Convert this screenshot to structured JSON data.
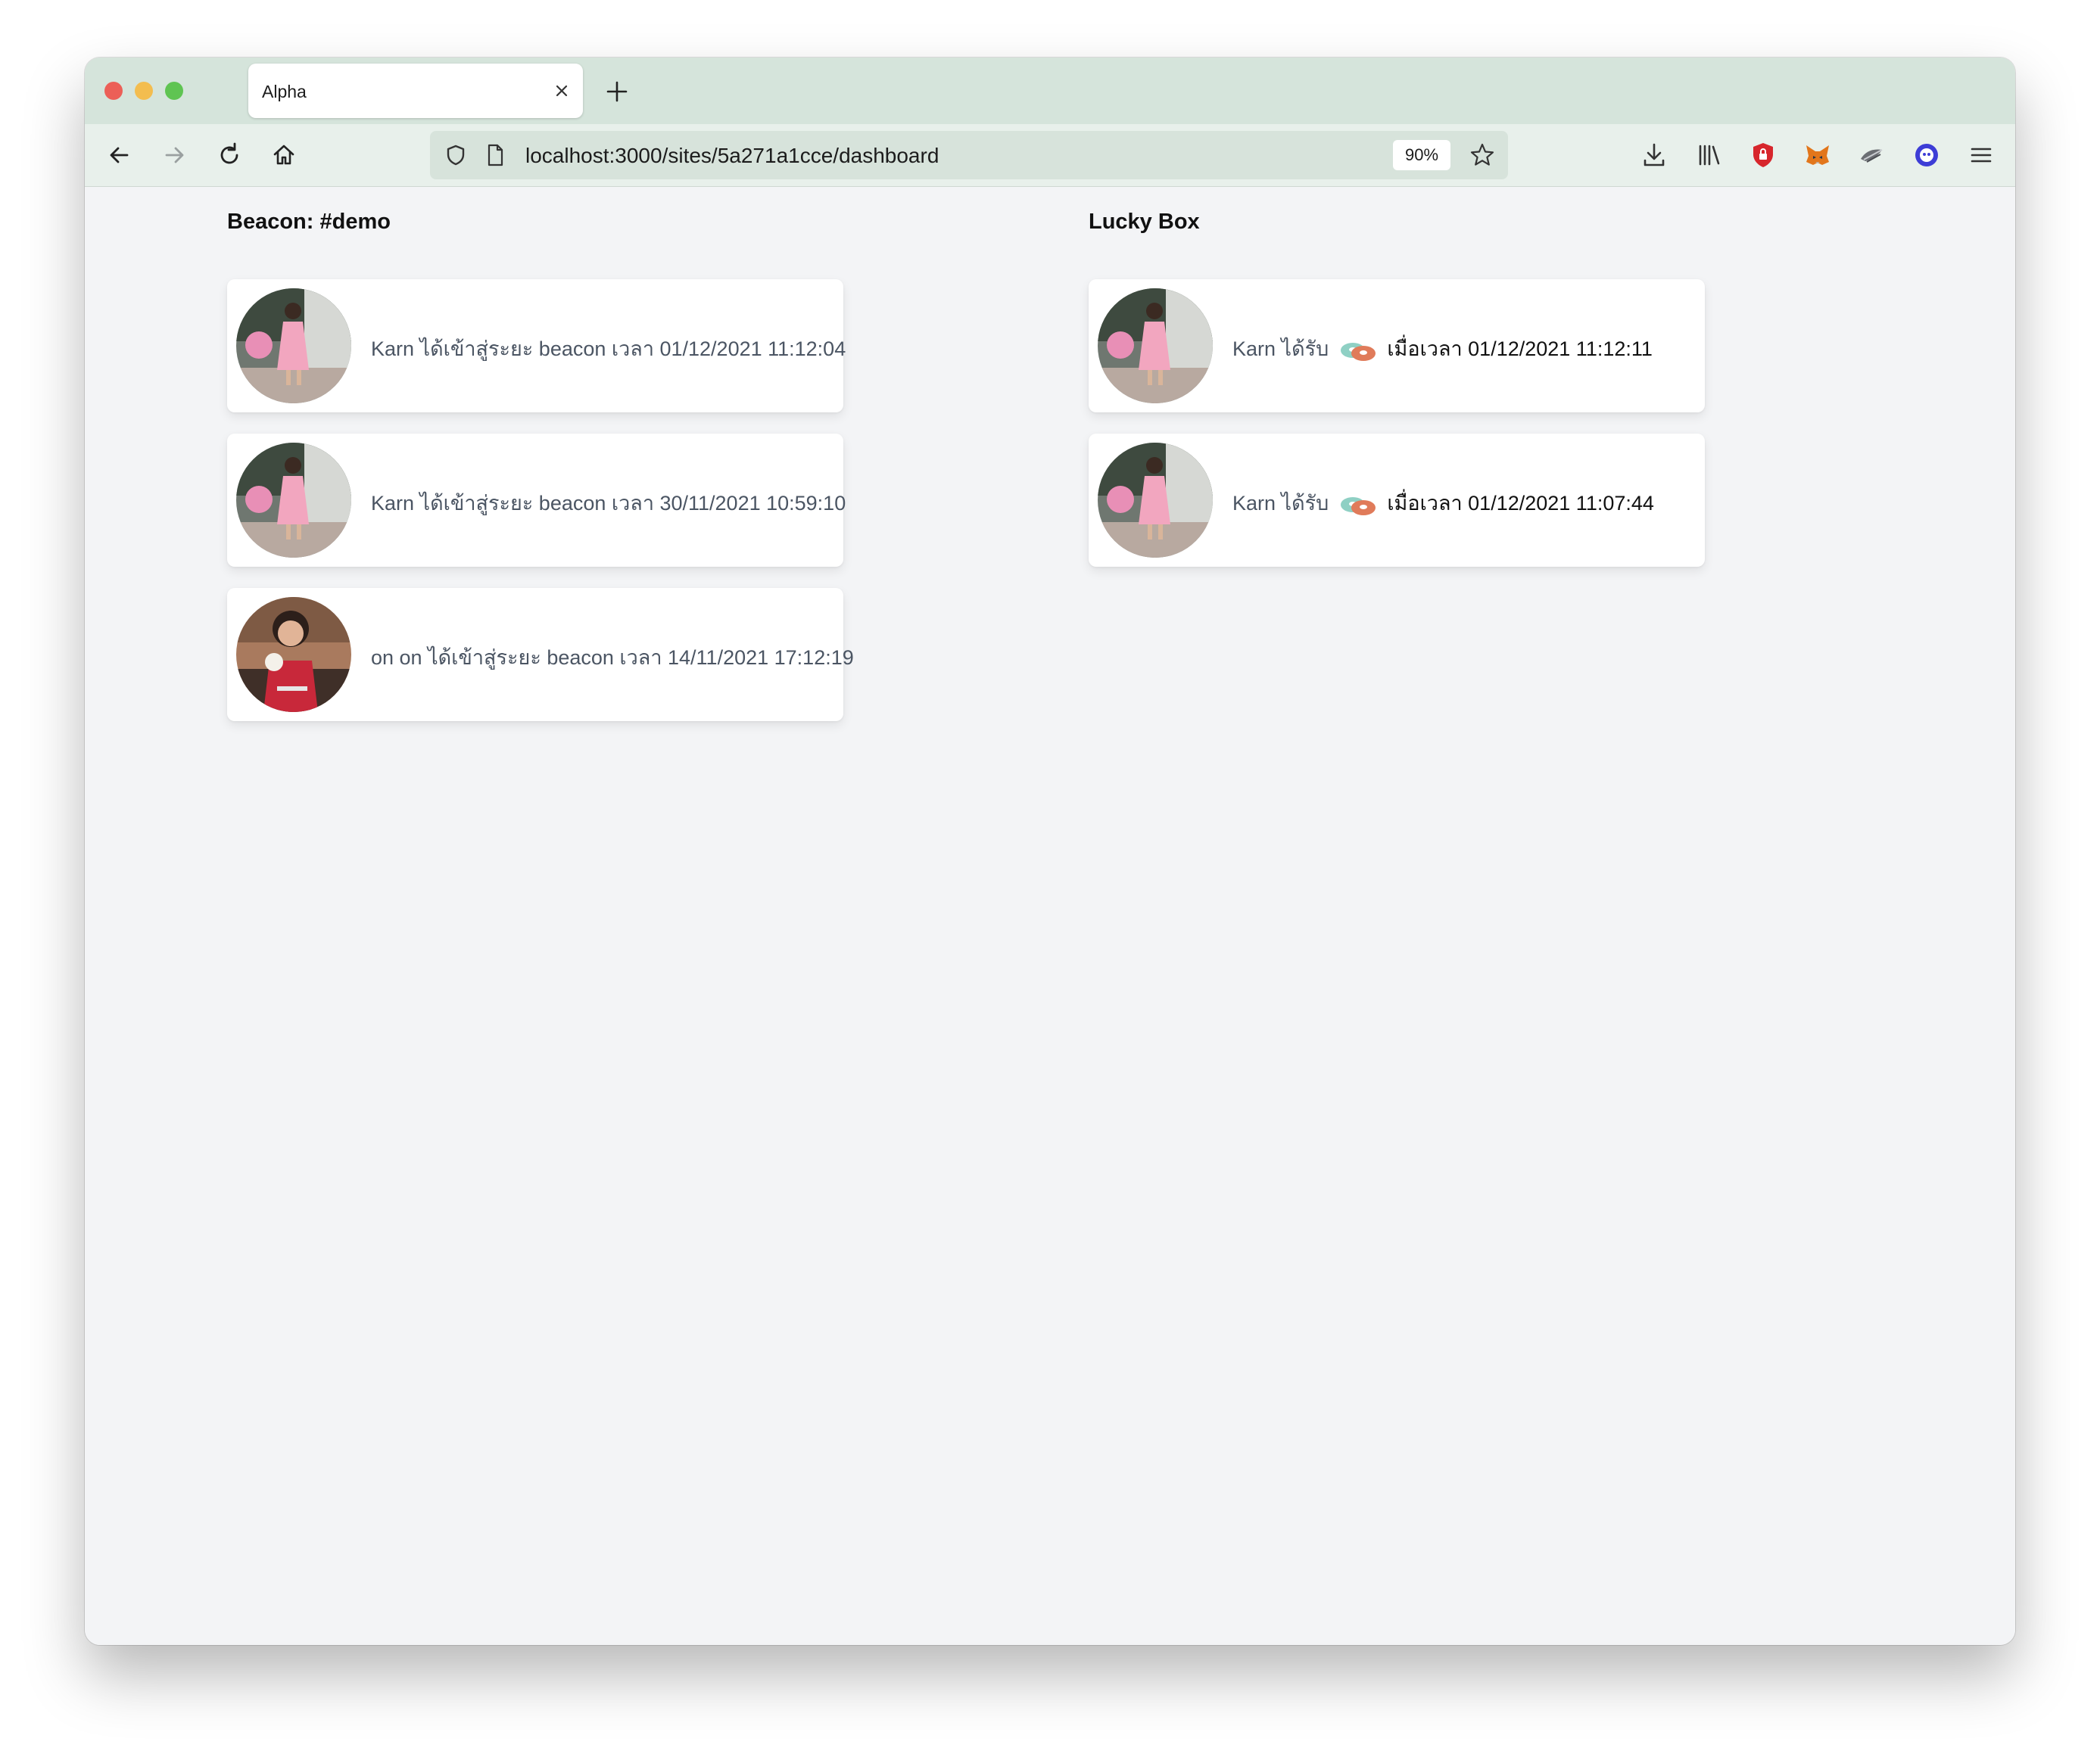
{
  "browser": {
    "tab_title": "Alpha",
    "url": "localhost:3000/sites/5a271a1cce/dashboard",
    "zoom": "90%"
  },
  "beacon": {
    "heading": "Beacon: #demo",
    "items": [
      {
        "name": "Karn",
        "text": "Karn ได้เข้าสู่ระยะ beacon เวลา 01/12/2021 11:12:04"
      },
      {
        "name": "Karn",
        "text": "Karn ได้เข้าสู่ระยะ beacon เวลา 30/11/2021 10:59:10"
      },
      {
        "name": "on on",
        "text": "on on ได้เข้าสู่ระยะ beacon เวลา 14/11/2021 17:12:19"
      }
    ]
  },
  "lucky": {
    "heading": "Lucky Box",
    "items": [
      {
        "prefix": "Karn ได้รับ",
        "suffix": "เมื่อเวลา 01/12/2021 11:12:11"
      },
      {
        "prefix": "Karn ได้รับ",
        "suffix": "เมื่อเวลา 01/12/2021 11:07:44"
      }
    ]
  },
  "icons": [
    "back-arrow-icon",
    "forward-arrow-icon",
    "reload-icon",
    "home-icon",
    "shield-icon",
    "page-icon",
    "star-icon",
    "download-icon",
    "library-icon",
    "ublock-icon",
    "metamask-icon",
    "extension-icon",
    "extension-circle-icon",
    "menu-icon",
    "close-icon",
    "plus-icon",
    "donut-gift-icon"
  ],
  "colors": {
    "tabbar": "#d5e4db",
    "navbar": "#e8f0eb",
    "content_bg": "#f3f4f6",
    "card": "#ffffff"
  }
}
